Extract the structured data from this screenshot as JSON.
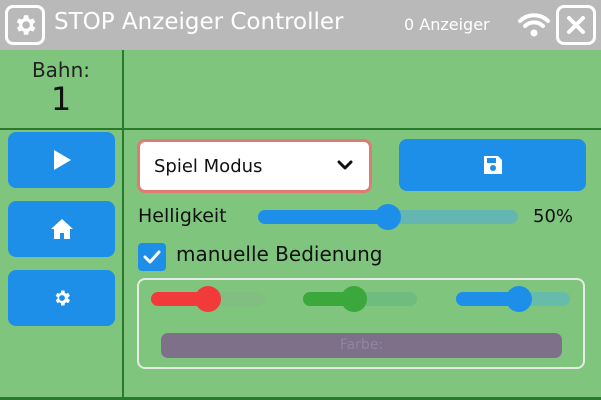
{
  "header": {
    "title": "STOP Anzeiger Controller",
    "device_count": "0 Anzeiger",
    "icons": [
      "gear-icon",
      "wifi-icon",
      "close-icon"
    ]
  },
  "lane": {
    "label": "Bahn:",
    "value": "1"
  },
  "sidebar": {
    "buttons": [
      {
        "name": "play",
        "icon": "play-icon"
      },
      {
        "name": "home",
        "icon": "home-icon"
      },
      {
        "name": "settings",
        "icon": "gear-icon"
      }
    ]
  },
  "mode": {
    "selected": "Spiel Modus"
  },
  "save": {
    "icon": "save-icon"
  },
  "brightness": {
    "label": "Helligkeit",
    "value_text": "50%",
    "level": 0.5
  },
  "manual": {
    "label": "manuelle Bedienung",
    "checked": true
  },
  "color": {
    "red_level": 0.5,
    "green_level": 0.45,
    "blue_level": 0.55,
    "preview_label": "Farbe:",
    "preview_color": "#7f708a"
  },
  "colors": {
    "accent": "#1d8fe8",
    "background": "#7fc57d",
    "titlebar": "#b9b9b9",
    "select_border": "#e07b74"
  }
}
